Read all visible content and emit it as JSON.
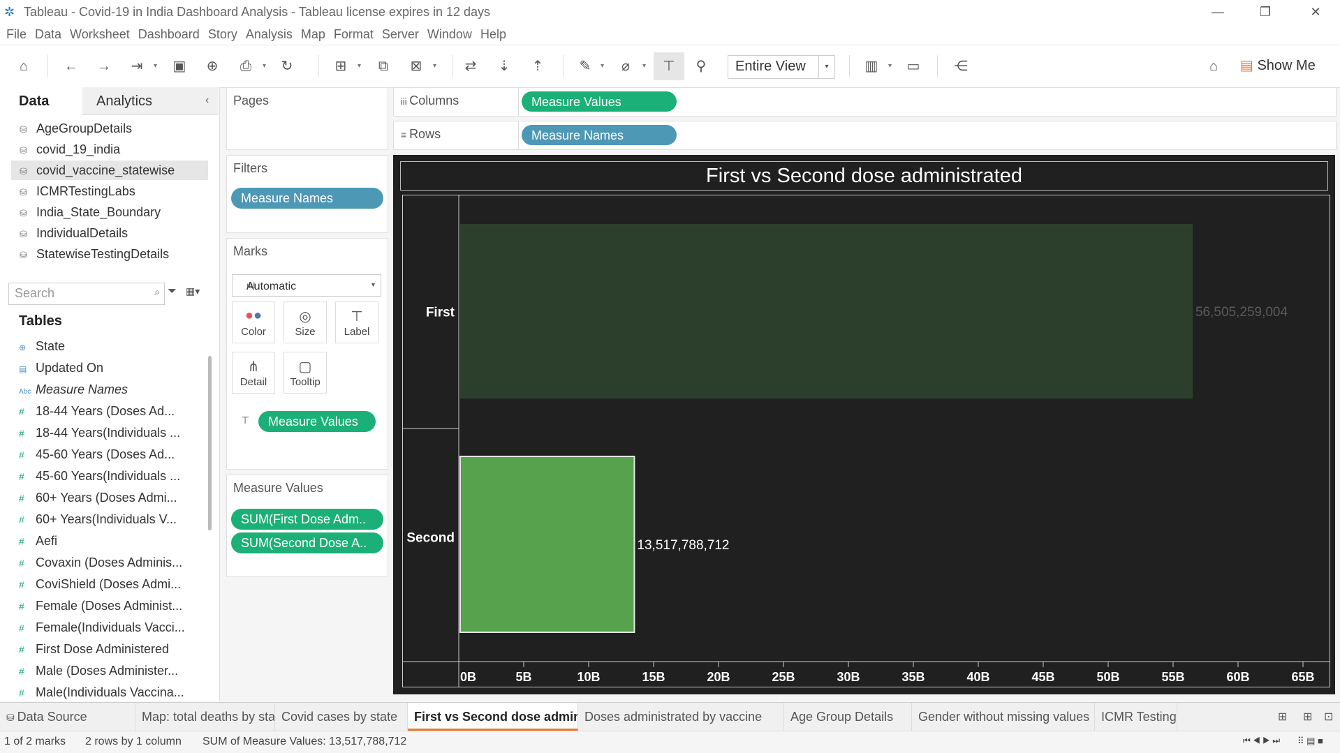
{
  "window": {
    "title": "Tableau - Covid-19 in India Dashboard Analysis - Tableau license expires in 12 days",
    "logo_icon": "tableau-logo-icon"
  },
  "menu": [
    "File",
    "Data",
    "Worksheet",
    "Dashboard",
    "Story",
    "Analysis",
    "Map",
    "Format",
    "Server",
    "Window",
    "Help"
  ],
  "toolbar": {
    "fit_label": "Entire View",
    "show_me_label": "Show Me"
  },
  "data_pane": {
    "tab_data": "Data",
    "tab_analytics": "Analytics",
    "data_sources": [
      "AgeGroupDetails",
      "covid_19_india",
      "covid_vaccine_statewise",
      "ICMRTestingLabs",
      "India_State_Boundary",
      "IndividualDetails",
      "StatewiseTestingDetails"
    ],
    "selected_source": "covid_vaccine_statewise",
    "search_placeholder": "Search",
    "tables_heading": "Tables",
    "dimensions": [
      {
        "label": "State",
        "icon": "globe-icon"
      },
      {
        "label": "Updated On",
        "icon": "calendar-icon"
      },
      {
        "label": "Measure Names",
        "icon": "abc-icon"
      }
    ],
    "measures": [
      "18-44 Years (Doses Ad...",
      "18-44 Years(Individuals ...",
      "45-60 Years (Doses Ad...",
      "45-60 Years(Individuals ...",
      "60+ Years (Doses Admi...",
      "60+ Years(Individuals V...",
      "Aefi",
      "Covaxin (Doses Adminis...",
      "CoviShield (Doses Admi...",
      "Female (Doses Administ...",
      "Female(Individuals Vacci...",
      "First Dose Administered",
      "Male (Doses Administer...",
      "Male(Individuals Vaccina..."
    ]
  },
  "cards": {
    "pages_label": "Pages",
    "filters_label": "Filters",
    "filter_pill": "Measure Names",
    "marks_label": "Marks",
    "mark_type": "Automatic",
    "mark_buttons": [
      "Color",
      "Size",
      "Label",
      "Detail",
      "Tooltip"
    ],
    "marks_pill": "Measure Values",
    "measure_values_label": "Measure Values",
    "measure_values_pills": [
      "SUM(First Dose Adm..",
      "SUM(Second Dose A.."
    ]
  },
  "shelves": {
    "columns_label": "Columns",
    "columns_pill": "Measure Values",
    "rows_label": "Rows",
    "rows_pill": "Measure Names"
  },
  "chart_data": {
    "type": "bar",
    "orientation": "horizontal",
    "title": "First vs Second dose administrated",
    "categories": [
      "First",
      "Second"
    ],
    "values": [
      56505259004,
      13517788712
    ],
    "value_labels": [
      "56,505,259,004",
      "13,517,788,712"
    ],
    "colors": [
      "#2c3f2c",
      "#57a24d"
    ],
    "xlim": [
      0,
      65000000000
    ],
    "x_ticks": [
      0,
      5000000000,
      10000000000,
      15000000000,
      20000000000,
      25000000000,
      30000000000,
      35000000000,
      40000000000,
      45000000000,
      50000000000,
      55000000000,
      60000000000,
      65000000000
    ],
    "x_tick_labels": [
      "0B",
      "5B",
      "10B",
      "15B",
      "20B",
      "25B",
      "30B",
      "35B",
      "40B",
      "45B",
      "50B",
      "55B",
      "60B",
      "65B"
    ],
    "background": "#202020"
  },
  "sheet_tabs": {
    "data_source": "Data Source",
    "tabs": [
      "Map: total deaths by state",
      "Covid cases by state",
      "First vs Second dose administr...",
      "Doses administrated by vaccine",
      "Age Group Details",
      "Gender without missing values",
      "ICMR Testing La"
    ],
    "active_index": 2
  },
  "status": {
    "marks": "1 of 2 marks",
    "dims": "2 rows by 1 column",
    "sum": "SUM of Measure Values: 13,517,788,712"
  }
}
